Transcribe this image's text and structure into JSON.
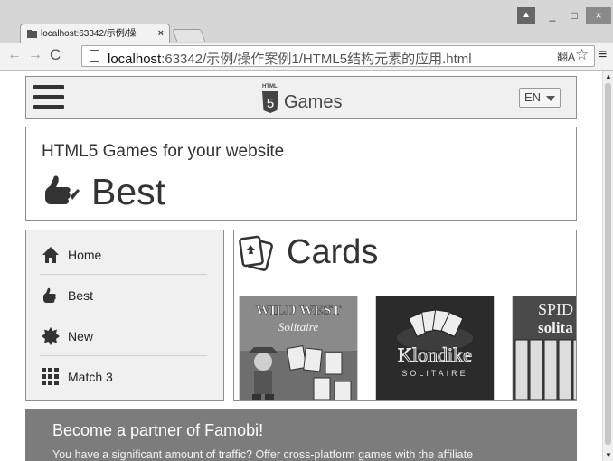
{
  "browser": {
    "tab_title": "localhost:63342/示例/操",
    "tab_close": "×",
    "url_host": "localhost",
    "url_path": ":63342/示例/操作案例1/HTML5结构元素的应用.html",
    "window_controls": {
      "user": "▲",
      "minimize": "_",
      "maximize": "□",
      "close": "×"
    },
    "nav": {
      "back": "←",
      "forward": "→",
      "reload": "C"
    },
    "icons": {
      "translate": "翻A",
      "star": "☆",
      "menu": "≡"
    }
  },
  "site": {
    "logo_small": "HTML",
    "logo_number": "5",
    "logo_word": "Games",
    "language": "EN"
  },
  "hero": {
    "subtitle": "HTML5 Games for your website",
    "title": "Best"
  },
  "sidebar": {
    "items": [
      {
        "label": "Home",
        "icon": "home-icon"
      },
      {
        "label": "Best",
        "icon": "thumbs-up-icon"
      },
      {
        "label": "New",
        "icon": "new-badge-icon"
      },
      {
        "label": "Match 3",
        "icon": "match3-grid-icon"
      }
    ]
  },
  "cards": {
    "title": "Cards",
    "games": [
      {
        "line1": "WILD WEST",
        "line2": "Solitaire"
      },
      {
        "line1": "Klondike",
        "line2": "SOLITAIRE"
      },
      {
        "line1": "SPID",
        "line2": "solita"
      }
    ]
  },
  "partner": {
    "title": "Become a partner of Famobi!",
    "text": "You have a significant amount of traffic? Offer cross-platform games with the affiliate"
  }
}
